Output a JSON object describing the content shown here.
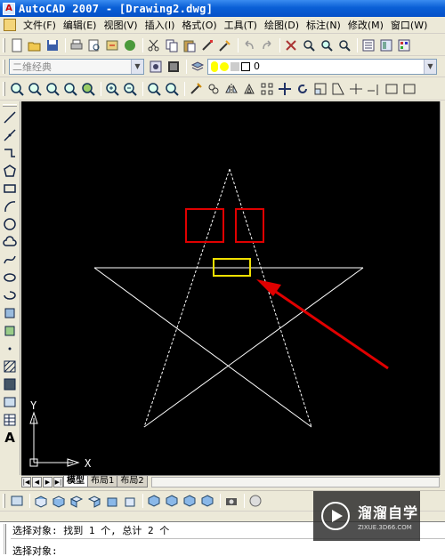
{
  "window": {
    "title": "AutoCAD 2007 - [Drawing2.dwg]",
    "icon_letter": "A"
  },
  "menu": {
    "items": [
      "文件(F)",
      "编辑(E)",
      "视图(V)",
      "插入(I)",
      "格式(O)",
      "工具(T)",
      "绘图(D)",
      "标注(N)",
      "修改(M)",
      "窗口(W)"
    ]
  },
  "toolbar2": {
    "workspace_combo": "二维经典",
    "layer_combo": "0"
  },
  "left_toolbar": {
    "text_tool_label": "A"
  },
  "canvas": {
    "background": "#000000",
    "ucs": {
      "x_label": "X",
      "y_label": "Y"
    },
    "annotation_colors": {
      "red_boxes": "#e00000",
      "yellow_box": "#f0e000",
      "arrow": "#e00000",
      "star": "#ffffff"
    }
  },
  "layout_tabs": {
    "tabs": [
      "模型",
      "布局1",
      "布局2"
    ],
    "active": "模型"
  },
  "command_line": {
    "line1": "选择对象: 找到 1 个, 总计 2 个",
    "line2": "选择对象:"
  },
  "watermark": {
    "name": "溜溜自学",
    "url": "ZIXUE.3D66.COM"
  }
}
